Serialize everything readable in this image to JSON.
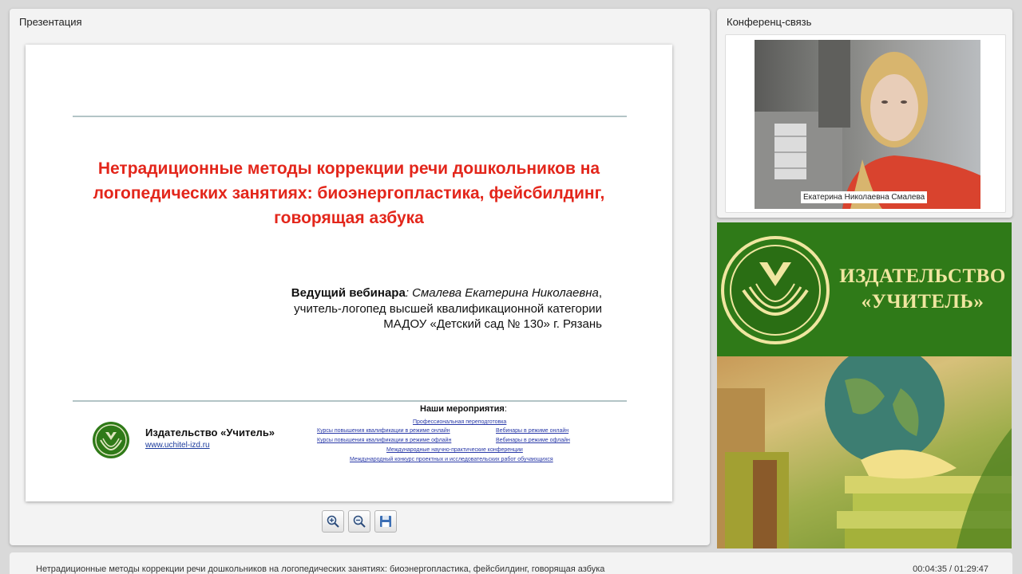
{
  "presentation": {
    "panel_title": "Презентация",
    "slide": {
      "title": "Нетрадиционные методы коррекции речи дошкольников на логопедических занятиях: биоэнергопластика, фейсбилдинг, говорящая азбука",
      "presenter_label": "Ведущий вебинара",
      "presenter_colon": ":",
      "presenter_name": "Смалева Екатерина Николаевна",
      "presenter_comma": ",",
      "presenter_position": "учитель-логопед высшей квалификационной категории",
      "presenter_org": "МАДОУ «Детский сад № 130» г. Рязань",
      "publisher_name": "Издательство «Учитель»",
      "publisher_url": "www.uchitel-izd.ru",
      "events_heading": "Наши мероприятия",
      "events_colon": ":",
      "events": {
        "retraining": "Профессиональная переподготовка",
        "courses_online": "Курсы повышения квалификации в режиме онлайн",
        "webinars_online": "Вебинары в режиме онлайн",
        "courses_offline": "Курсы повышения квалификации в режиме офлайн",
        "webinars_offline": "Вебинары в режиме офлайн",
        "conferences": "Международные научно-практические конференции",
        "contest": "Международный конкурс проектных и исследовательских работ обучающихся"
      }
    },
    "toolbar": {
      "zoom_in_icon": "zoom-in-icon",
      "zoom_out_icon": "zoom-out-icon",
      "save_icon": "floppy-disk-icon"
    }
  },
  "conference": {
    "panel_title": "Конференц-связь",
    "participant_name": "Екатерина Николаевна Смалева"
  },
  "banner": {
    "title_line1": "ИЗДАТЕЛЬСТВО",
    "title_line2": "«УЧИТЕЛЬ»"
  },
  "footer": {
    "title": "Нетрадиционные методы коррекции речи дошкольников на логопедических занятиях: биоэнергопластика, фейсбилдинг, говорящая азбука",
    "elapsed": "00:04:35",
    "separator": " / ",
    "duration": "01:29:47"
  },
  "colors": {
    "slide_title": "#e3261b",
    "brand_green": "#2f7a18",
    "banner_text": "#f0e6a0",
    "link": "#2a3aa8"
  }
}
